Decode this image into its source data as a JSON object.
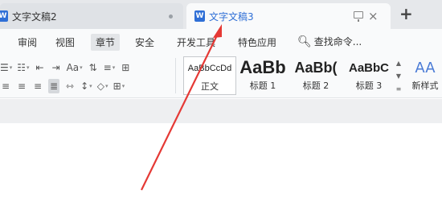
{
  "tabs": [
    {
      "title": "文字文稿2",
      "active": false
    },
    {
      "title": "文字文稿3",
      "active": true
    }
  ],
  "doc_icon_glyph": "W",
  "new_tab_glyph": "+",
  "close_glyph": "×",
  "menu": {
    "items": [
      "审阅",
      "视图",
      "章节",
      "安全",
      "开发工具",
      "特色应用"
    ],
    "active": "章节",
    "search_label": "查找命令..."
  },
  "styles": [
    {
      "sample": "AaBbCcDd",
      "label": "正文"
    },
    {
      "sample": "AaBb",
      "label": "标题 1"
    },
    {
      "sample": "AaBb(",
      "label": "标题 2"
    },
    {
      "sample": "AaBbC",
      "label": "标题 3"
    }
  ],
  "new_style": {
    "icon": "AA",
    "label": "新样式"
  },
  "colors": {
    "accent": "#2f6fd6",
    "arrow": "#e53935"
  },
  "icons": {
    "row1": [
      "list-bullets-icon",
      "list-numbers-icon",
      "indent-decrease-icon",
      "indent-increase-icon",
      "font-size-icon",
      "sort-icon",
      "line-spacing-icon",
      "table-insert-icon"
    ],
    "row2": [
      "align-left-icon",
      "align-center-icon",
      "align-right-icon",
      "align-justify-icon",
      "distribute-icon",
      "paragraph-spacing-icon",
      "shading-icon",
      "border-icon"
    ]
  }
}
